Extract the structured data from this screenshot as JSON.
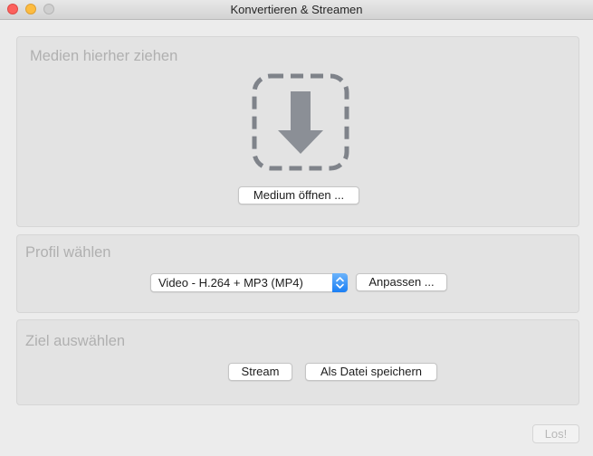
{
  "window": {
    "title": "Konvertieren & Streamen"
  },
  "media": {
    "heading": "Medien hierher ziehen",
    "drop_icon": "drop-arrow-icon",
    "open_button": "Medium öffnen ..."
  },
  "profile": {
    "heading": "Profil wählen",
    "selected": "Video - H.264 + MP3 (MP4)",
    "adjust_button": "Anpassen ..."
  },
  "destination": {
    "heading": "Ziel auswählen",
    "stream_button": "Stream",
    "save_button": "Als Datei speichern"
  },
  "footer": {
    "go_button": "Los!"
  },
  "colors": {
    "close": "#fc605c",
    "minimize": "#fdbc40",
    "zoom": "#cfcfcf",
    "select_accent": "#1a7ff5"
  }
}
